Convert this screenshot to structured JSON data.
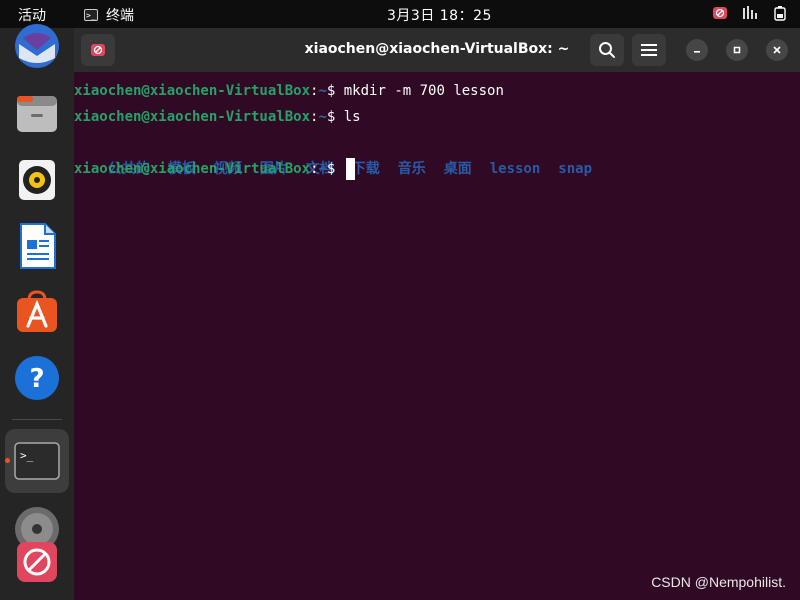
{
  "topbar": {
    "activities": "活动",
    "app_name": "终端",
    "clock": "3月3日  18：25"
  },
  "window": {
    "title": "xiaochen@xiaochen-VirtualBox: ~"
  },
  "terminal": {
    "lines": [
      {
        "user": "xiaochen@xiaochen-VirtualBox",
        "path": "~",
        "cmd": "mkdir -m 700 lesson"
      },
      {
        "user": "xiaochen@xiaochen-VirtualBox",
        "path": "~",
        "cmd": "ls"
      }
    ],
    "ls_output": [
      "公共的",
      "模板",
      "视频",
      "图片",
      "文档",
      "下载",
      "音乐",
      "桌面",
      "lesson",
      "snap"
    ],
    "current_prompt": {
      "user": "xiaochen@xiaochen-VirtualBox",
      "path": "~"
    }
  },
  "watermark": "CSDN @Nempohilist.",
  "icons": {
    "dock": [
      "thunderbird-icon",
      "files-icon",
      "rhythmbox-icon",
      "libreoffice-writer-icon",
      "app-center-icon",
      "help-icon",
      "terminal-icon",
      "disc-icon",
      "no-entry-icon"
    ],
    "headerbar": [
      "new-tab-icon",
      "search-icon",
      "hamburger-menu-icon",
      "minimize-icon",
      "maximize-icon",
      "close-icon"
    ],
    "tray": [
      "record-icon",
      "network-icon",
      "battery-icon"
    ]
  },
  "colors": {
    "terminal_bg": "#300a24",
    "prompt_user": "#26a269",
    "prompt_path": "#3465a4",
    "dir_color": "#2a5aa6",
    "accent": "#e95420"
  }
}
